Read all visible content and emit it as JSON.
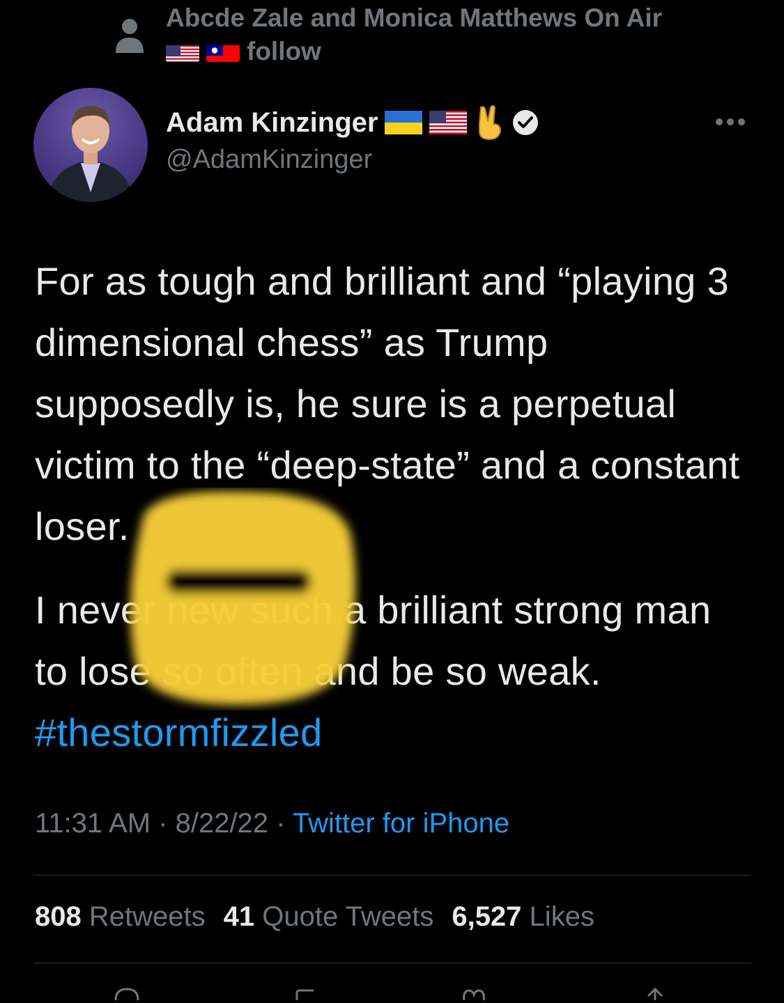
{
  "social_context": {
    "line1": "Abcde Zale and Monica Matthews On Air",
    "line2": "follow",
    "flags": [
      "us-flag-icon",
      "taiwan-flag-icon"
    ]
  },
  "author": {
    "display_name": "Adam Kinzinger",
    "handle": "@AdamKinzinger",
    "name_emojis": [
      "ukraine-flag-icon",
      "us-flag-icon",
      "victory-hand-icon",
      "verified-badge-icon"
    ]
  },
  "tweet": {
    "paragraph1": "For as tough and brilliant and “playing 3 dimensional chess” as Trump supposedly is, he sure is a perpetual victim to the “deep-state” and a constant loser.",
    "paragraph2_text": "I never new such a brilliant strong man to lose so often and be so weak. ",
    "hashtag": "#thestormfizzled"
  },
  "meta": {
    "time": "11:31 AM",
    "separator": " · ",
    "date": "8/22/22",
    "source": "Twitter for iPhone"
  },
  "stats": {
    "retweets_count": "808",
    "retweets_label": "Retweets",
    "quotes_count": "41",
    "quotes_label": "Quote Tweets",
    "likes_count": "6,527",
    "likes_label": "Likes"
  },
  "colors": {
    "background": "#000000",
    "text": "#e7e9ea",
    "muted": "#71767b",
    "link": "#1d9bf0",
    "redaction": "#f5cd3a"
  }
}
